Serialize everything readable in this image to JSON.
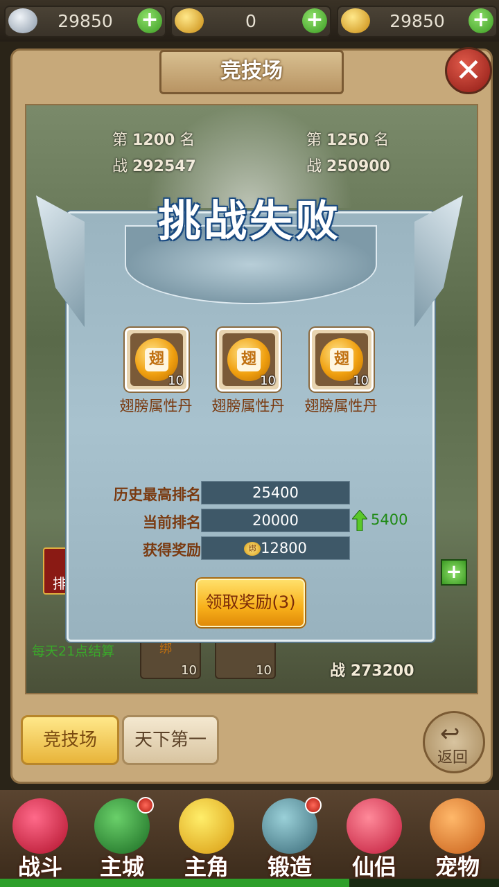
{
  "currencies": [
    {
      "icon": "silver-ingot-icon",
      "value": "29850"
    },
    {
      "icon": "gold-ingot-icon",
      "value": "0"
    },
    {
      "icon": "gold-ingot-icon",
      "value": "29850"
    }
  ],
  "window": {
    "title": "竞技场",
    "close_glyph": "✕"
  },
  "opponents": [
    {
      "rank_prefix": "第",
      "rank": "1200",
      "rank_suffix": "名",
      "power_prefix": "战",
      "power": "292547"
    },
    {
      "rank_prefix": "第",
      "rank": "1250",
      "rank_suffix": "名",
      "power_prefix": "战",
      "power": "250900"
    }
  ],
  "background": {
    "daily_note": "每天21点结算",
    "reward_counts": [
      "10",
      "10"
    ],
    "bind_tag": "绑",
    "player_power_prefix": "战",
    "player_power": "273200",
    "side_label": "排"
  },
  "dialog": {
    "title": "挑战失败",
    "rewards": [
      {
        "name": "翅膀属性丹",
        "glyph": "翅",
        "count": "10"
      },
      {
        "name": "翅膀属性丹",
        "glyph": "翅",
        "count": "10"
      },
      {
        "name": "翅膀属性丹",
        "glyph": "翅",
        "count": "10"
      }
    ],
    "stats": {
      "best_rank_label": "历史最高排名",
      "best_rank_value": "25400",
      "current_rank_label": "当前排名",
      "current_rank_value": "20000",
      "rank_change": "5400",
      "reward_label": "获得奖励",
      "reward_value": "12800",
      "reward_tag": "绑"
    },
    "claim_button": "领取奖励(3)"
  },
  "tabs": {
    "arena": "竞技场",
    "world_first": "天下第一",
    "back": "返回"
  },
  "nav": [
    {
      "label": "战斗",
      "icon": "battle-icon",
      "badge": false
    },
    {
      "label": "主城",
      "icon": "city-icon",
      "badge": true
    },
    {
      "label": "主角",
      "icon": "hero-icon",
      "badge": false
    },
    {
      "label": "锻造",
      "icon": "forge-icon",
      "badge": true
    },
    {
      "label": "仙侣",
      "icon": "partner-icon",
      "badge": false
    },
    {
      "label": "宠物",
      "icon": "pet-icon",
      "badge": false
    }
  ],
  "colors": {
    "rank_up": "#1e8a14",
    "label_brown": "#7a3a10"
  },
  "progress": 0.7
}
